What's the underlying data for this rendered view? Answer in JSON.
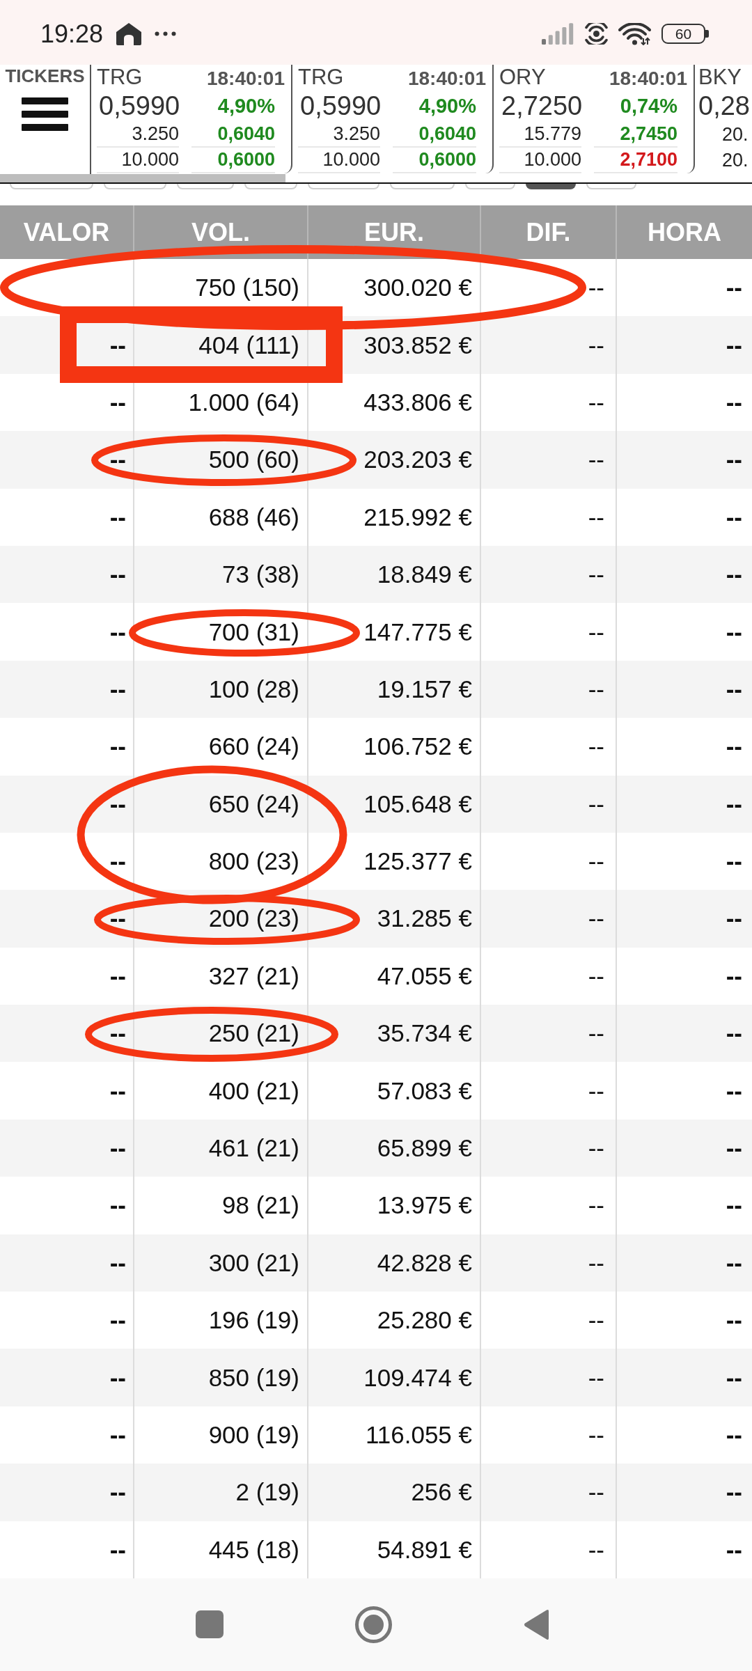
{
  "status_bar": {
    "time": "19:28",
    "battery": "60"
  },
  "tickers": {
    "label": "TICKERS",
    "items": [
      {
        "symbol": "TRG",
        "time": "18:40:01",
        "price": "0,5990",
        "change": "4,90%",
        "color": "#1f8a1f",
        "rows": [
          {
            "volume": "3.250",
            "price": "0,6040",
            "color": "#1f8a1f"
          },
          {
            "volume": "10.000",
            "price": "0,6000",
            "color": "#1f8a1f"
          }
        ]
      },
      {
        "symbol": "TRG",
        "time": "18:40:01",
        "price": "0,5990",
        "change": "4,90%",
        "color": "#1f8a1f",
        "rows": [
          {
            "volume": "3.250",
            "price": "0,6040",
            "color": "#1f8a1f"
          },
          {
            "volume": "10.000",
            "price": "0,6000",
            "color": "#1f8a1f"
          }
        ]
      },
      {
        "symbol": "ORY",
        "time": "18:40:01",
        "price": "2,7250",
        "change": "0,74%",
        "color": "#1f8a1f",
        "rows": [
          {
            "volume": "15.779",
            "price": "2,7450",
            "color": "#1f8a1f"
          },
          {
            "volume": "10.000",
            "price": "2,7100",
            "color": "#d3191c"
          }
        ]
      },
      {
        "symbol": "BKY",
        "price": "0,28",
        "rows": [
          {
            "volume": "20."
          },
          {
            "volume": "20."
          }
        ]
      }
    ]
  },
  "filter_chips": [
    {
      "selected": false
    },
    {
      "selected": false
    },
    {
      "selected": false
    },
    {
      "selected": false
    },
    {
      "selected": false
    },
    {
      "selected": false
    },
    {
      "selected": false
    },
    {
      "selected": true
    },
    {
      "selected": false
    }
  ],
  "table": {
    "columns": [
      "VALOR",
      "VOL.",
      "EUR.",
      "DIF.",
      "HORA"
    ],
    "rows": [
      {
        "vol": "750 (150)",
        "eur": "300.020 €",
        "dif": "--",
        "hora": "--"
      },
      {
        "valor": "--",
        "vol": "404 (111)",
        "eur": "303.852 €",
        "dif": "--",
        "hora": "--"
      },
      {
        "valor": "--",
        "vol": "1.000 (64)",
        "eur": "433.806 €",
        "dif": "--",
        "hora": "--"
      },
      {
        "valor": "--",
        "vol": "500 (60)",
        "eur": "203.203 €",
        "dif": "--",
        "hora": "--"
      },
      {
        "valor": "--",
        "vol": "688 (46)",
        "eur": "215.992 €",
        "dif": "--",
        "hora": "--"
      },
      {
        "valor": "--",
        "vol": "73 (38)",
        "eur": "18.849 €",
        "dif": "--",
        "hora": "--"
      },
      {
        "valor": "--",
        "vol": "700 (31)",
        "eur": "147.775 €",
        "dif": "--",
        "hora": "--"
      },
      {
        "valor": "--",
        "vol": "100 (28)",
        "eur": "19.157 €",
        "dif": "--",
        "hora": "--"
      },
      {
        "valor": "--",
        "vol": "660 (24)",
        "eur": "106.752 €",
        "dif": "--",
        "hora": "--"
      },
      {
        "valor": "--",
        "vol": "650 (24)",
        "eur": "105.648 €",
        "dif": "--",
        "hora": "--"
      },
      {
        "valor": "--",
        "vol": "800 (23)",
        "eur": "125.377 €",
        "dif": "--",
        "hora": "--"
      },
      {
        "valor": "--",
        "vol": "200 (23)",
        "eur": "31.285 €",
        "dif": "--",
        "hora": "--"
      },
      {
        "valor": "--",
        "vol": "327 (21)",
        "eur": "47.055 €",
        "dif": "--",
        "hora": "--"
      },
      {
        "valor": "--",
        "vol": "250 (21)",
        "eur": "35.734 €",
        "dif": "--",
        "hora": "--"
      },
      {
        "valor": "--",
        "vol": "400 (21)",
        "eur": "57.083 €",
        "dif": "--",
        "hora": "--"
      },
      {
        "valor": "--",
        "vol": "461 (21)",
        "eur": "65.899 €",
        "dif": "--",
        "hora": "--"
      },
      {
        "valor": "--",
        "vol": "98 (21)",
        "eur": "13.975 €",
        "dif": "--",
        "hora": "--"
      },
      {
        "valor": "--",
        "vol": "300 (21)",
        "eur": "42.828 €",
        "dif": "--",
        "hora": "--"
      },
      {
        "valor": "--",
        "vol": "196 (19)",
        "eur": "25.280 €",
        "dif": "--",
        "hora": "--"
      },
      {
        "valor": "--",
        "vol": "850 (19)",
        "eur": "109.474 €",
        "dif": "--",
        "hora": "--"
      },
      {
        "valor": "--",
        "vol": "900 (19)",
        "eur": "116.055 €",
        "dif": "--",
        "hora": "--"
      },
      {
        "valor": "--",
        "vol": "2 (19)",
        "eur": "256 €",
        "dif": "--",
        "hora": "--"
      },
      {
        "valor": "--",
        "vol": "445 (18)",
        "eur": "54.891 €",
        "dif": "--",
        "hora": "--"
      }
    ]
  },
  "annotations": [
    {
      "kind": "ellipse"
    },
    {
      "kind": "rectangle"
    },
    {
      "kind": "ellipse"
    },
    {
      "kind": "ellipse"
    },
    {
      "kind": "ellipse"
    },
    {
      "kind": "ellipse"
    },
    {
      "kind": "ellipse"
    }
  ]
}
